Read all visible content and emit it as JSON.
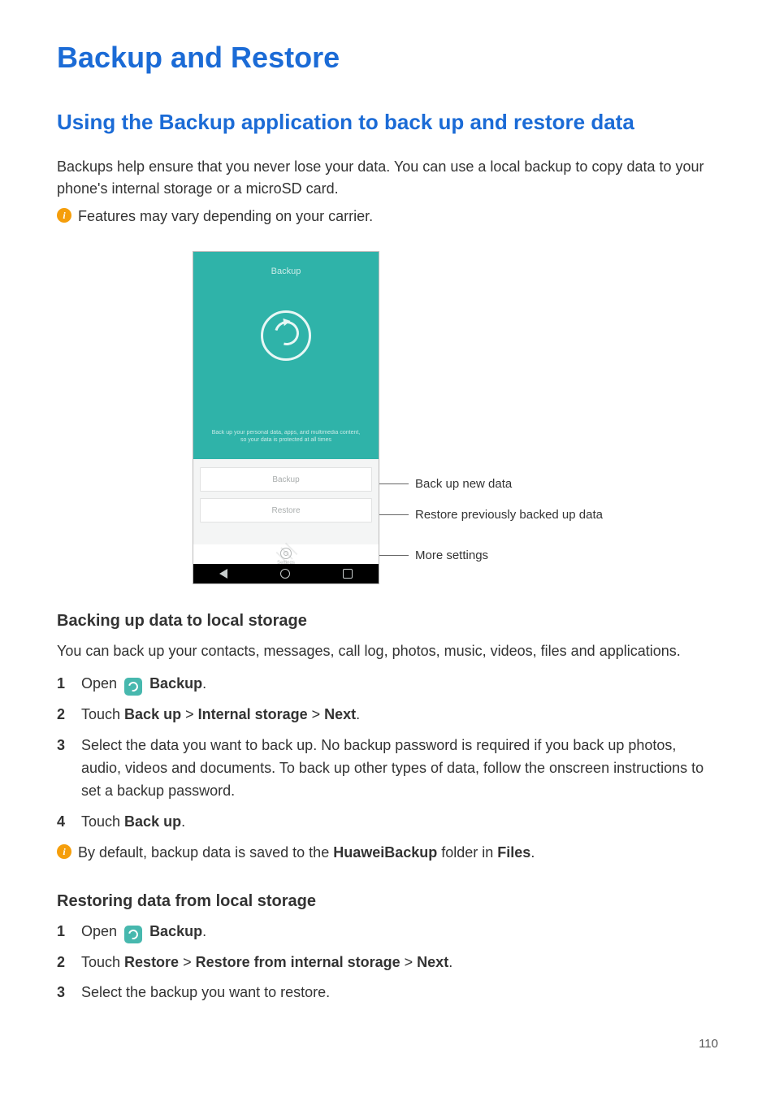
{
  "title": "Backup and Restore",
  "section_title": "Using the Backup application to back up and restore data",
  "intro": "Backups help ensure that you never lose your data. You can use a local backup to copy data to your phone's internal storage or a microSD card.",
  "info1": "Features may vary depending on your carrier.",
  "phone": {
    "header": "Backup",
    "caption_line1": "Back up your personal data, apps, and multimedia content,",
    "caption_line2": "so your data is protected at all times",
    "btn_backup": "Backup",
    "btn_restore": "Restore",
    "settings_label": "Settings"
  },
  "callouts": {
    "backup": "Back up new data",
    "restore": "Restore previously backed up data",
    "settings": "More settings"
  },
  "h3_backup": "Backing up data to local storage",
  "backup_intro": "You can back up your contacts, messages, call log, photos, music, videos, files and applications.",
  "steps_backup": {
    "s1_a": "Open ",
    "s1_b": "Backup",
    "s1_c": ".",
    "s2_a": "Touch ",
    "s2_b": "Back up",
    "s2_c": "Internal storage",
    "s2_d": "Next",
    "s2_sep": " > ",
    "s2_end": ".",
    "s3": "Select the data you want to back up. No backup password is required if you back up photos, audio, videos and documents. To back up other types of data, follow the onscreen instructions to set a backup password.",
    "s4_a": "Touch ",
    "s4_b": "Back up",
    "s4_c": "."
  },
  "info2_a": "By default, backup data is saved to the ",
  "info2_b": "HuaweiBackup",
  "info2_c": " folder in ",
  "info2_d": "Files",
  "info2_e": ".",
  "h3_restore": "Restoring data from local storage",
  "steps_restore": {
    "s1_a": "Open ",
    "s1_b": "Backup",
    "s1_c": ".",
    "s2_a": "Touch ",
    "s2_b": "Restore",
    "s2_c": "Restore from internal storage",
    "s2_d": "Next",
    "s2_sep": " > ",
    "s2_end": ".",
    "s3": "Select the backup you want to restore."
  },
  "page_number": "110"
}
